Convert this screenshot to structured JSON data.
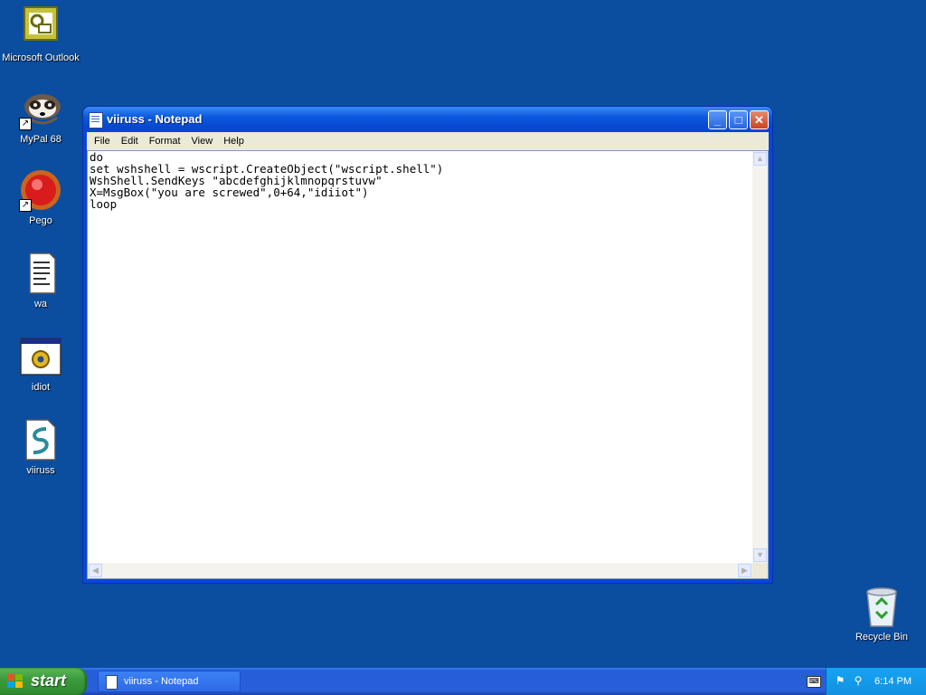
{
  "desktop": {
    "icons": [
      {
        "label": "Microsoft Outlook",
        "icon": "outlook-icon"
      },
      {
        "label": "MyPal 68",
        "icon": "mypal-icon"
      },
      {
        "label": "Pego",
        "icon": "pego-icon"
      },
      {
        "label": "wa",
        "icon": "text-document-icon"
      },
      {
        "label": "idiot",
        "icon": "program-window-icon"
      },
      {
        "label": "viiruss",
        "icon": "script-file-icon"
      },
      {
        "label": "Recycle Bin",
        "icon": "recycle-bin-icon"
      }
    ]
  },
  "window": {
    "title": "viiruss - Notepad",
    "buttons": {
      "minimize": "_",
      "maximize": "□",
      "close": "✕"
    },
    "menu": [
      "File",
      "Edit",
      "Format",
      "View",
      "Help"
    ],
    "content": "do\nset wshshell = wscript.CreateObject(\"wscript.shell\")\nWshShell.SendKeys \"abcdefghijklmnopqrstuvw\"\nX=MsgBox(\"you are screwed\",0+64,\"idiiot\")\nloop"
  },
  "taskbar": {
    "start_label": "start",
    "task_button": "viiruss - Notepad",
    "clock": "6:14 PM"
  },
  "colors": {
    "desktop": "#0b4d9e",
    "titlebar": "#0a5ae0",
    "start_button": "#3c9c3c",
    "tray": "#1290e0"
  }
}
